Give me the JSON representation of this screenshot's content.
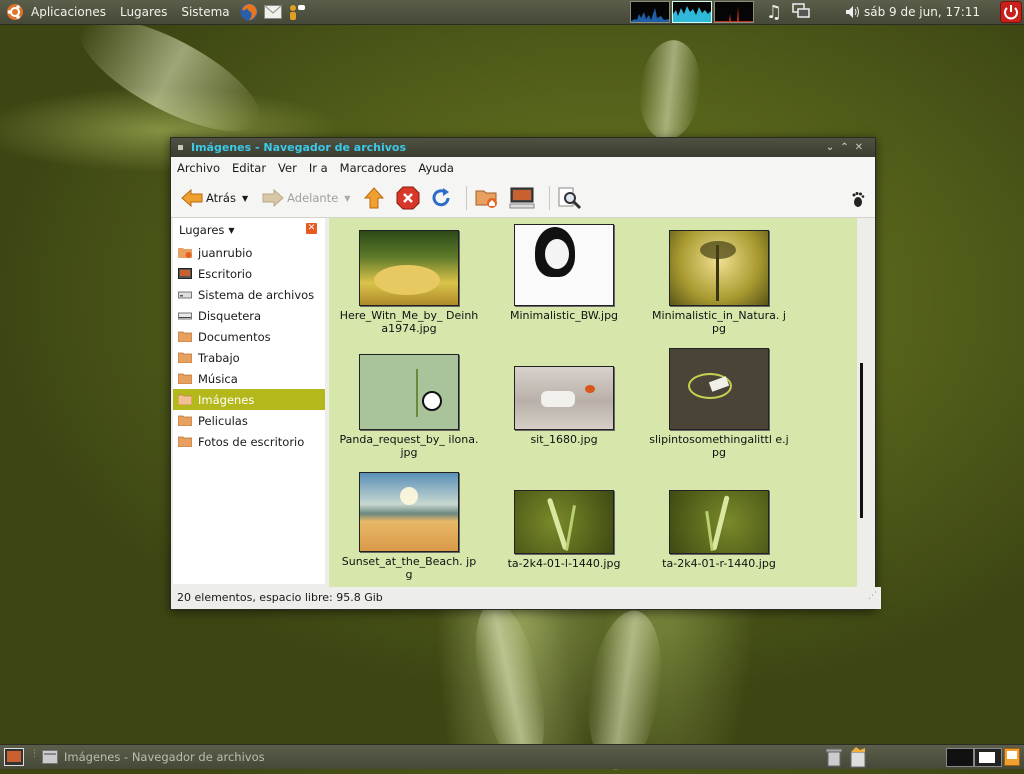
{
  "top_panel": {
    "menus": [
      "Aplicaciones",
      "Lugares",
      "Sistema"
    ],
    "launchers": [
      "firefox-icon",
      "mail-icon",
      "messenger-icon"
    ],
    "clock": "sáb  9 de jun, 17:11"
  },
  "window": {
    "title": "Imágenes - Navegador de archivos",
    "menubar": [
      "Archivo",
      "Editar",
      "Ver",
      "Ir a",
      "Marcadores",
      "Ayuda"
    ],
    "toolbar": {
      "back": "Atrás",
      "forward": "Adelante"
    },
    "sidebar": {
      "header": "Lugares",
      "places": [
        {
          "label": "juanrubio",
          "icon": "home-folder-icon"
        },
        {
          "label": "Escritorio",
          "icon": "desktop-icon"
        },
        {
          "label": "Sistema de archivos",
          "icon": "drive-icon"
        },
        {
          "label": "Disquetera",
          "icon": "floppy-icon"
        },
        {
          "label": "Documentos",
          "icon": "folder-icon"
        },
        {
          "label": "Trabajo",
          "icon": "folder-icon"
        },
        {
          "label": "Música",
          "icon": "folder-icon"
        },
        {
          "label": "Imágenes",
          "icon": "folder-icon",
          "selected": true
        },
        {
          "label": "Peliculas",
          "icon": "folder-icon"
        },
        {
          "label": "Fotos de escritorio",
          "icon": "folder-icon"
        }
      ]
    },
    "files": [
      "Here_Witn_Me_by_ Deinha1974.jpg",
      "Minimalistic_BW.jpg",
      "Minimalistic_in_Natura. jpg",
      "Panda_request_by_ ilona.jpg",
      "sit_1680.jpg",
      "slipintosomethingalittl e.jpg",
      "Sunset_at_the_Beach. jpg",
      "ta-2k4-01-l-1440.jpg",
      "ta-2k4-01-r-1440.jpg"
    ],
    "status": "20 elementos, espacio libre: 95.8 Gib"
  },
  "bottom_panel": {
    "task": "Imágenes - Navegador de archivos"
  },
  "colors": {
    "accent_selection": "#b5b81a",
    "title_text": "#3bc9e8",
    "content_bg": "#d7e7ab"
  }
}
